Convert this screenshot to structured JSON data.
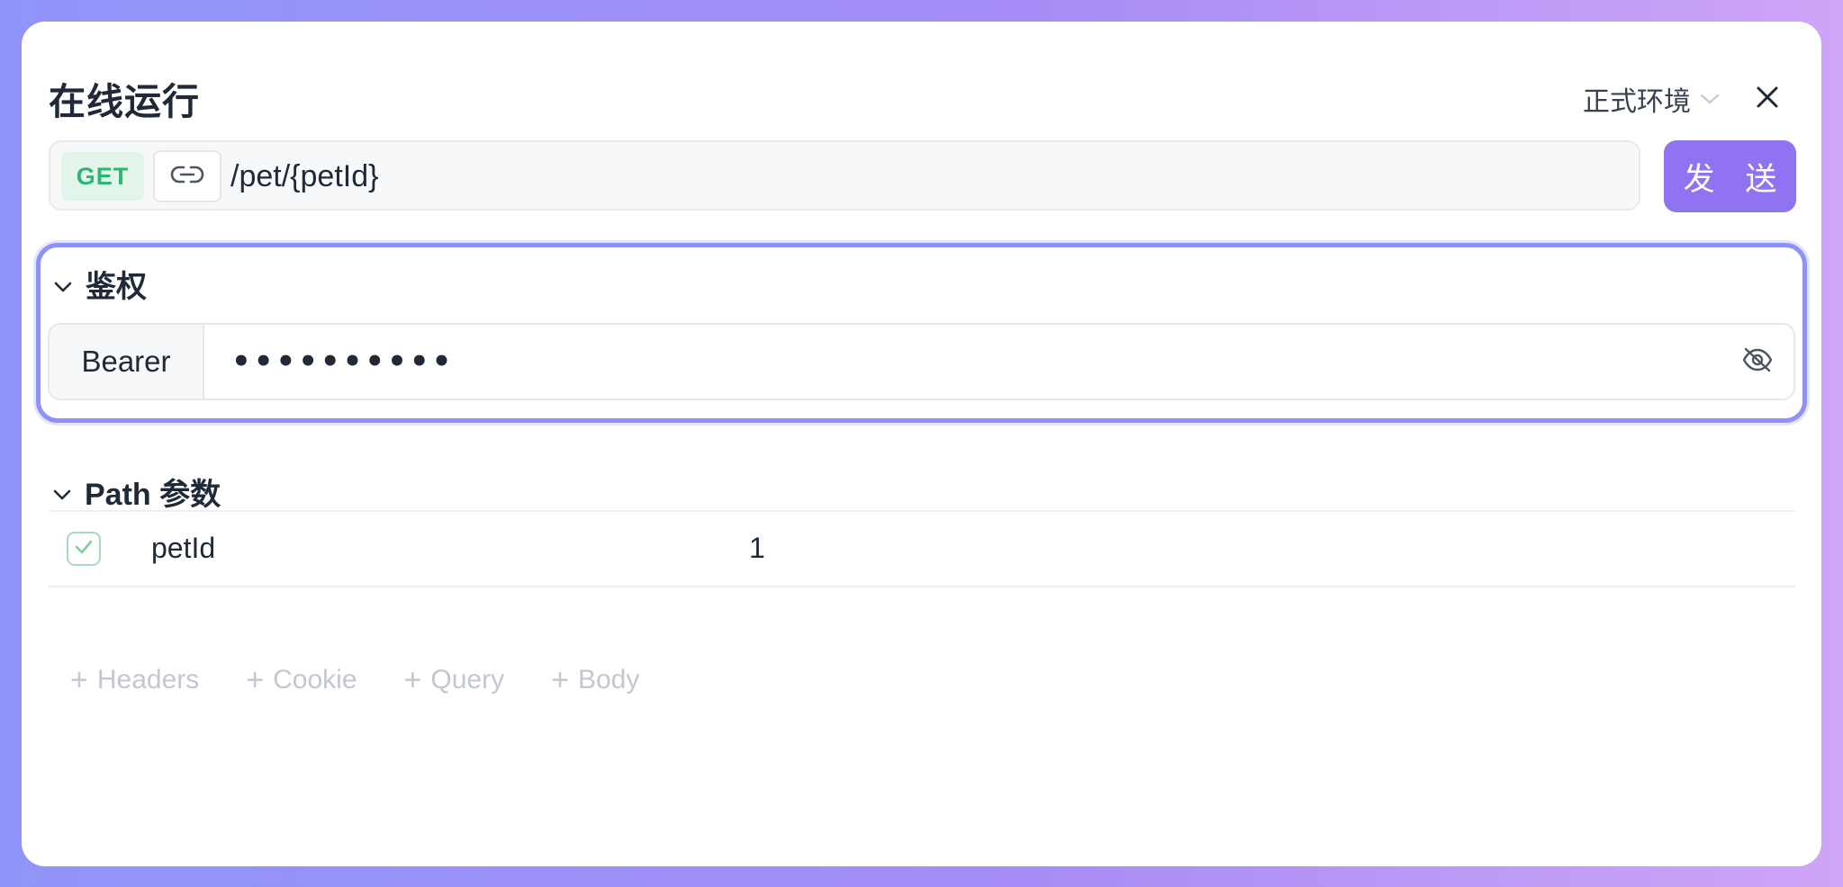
{
  "dialog": {
    "title": "在线运行",
    "environment": "正式环境",
    "close_label": "×"
  },
  "request": {
    "method": "GET",
    "path": "/pet/{petId}",
    "send_label": "发 送"
  },
  "auth": {
    "section_title": "鉴权",
    "type": "Bearer",
    "token_masked": "••••••••••"
  },
  "path_params": {
    "section_title": "Path 参数",
    "rows": [
      {
        "checked": true,
        "name": "petId",
        "value": "1"
      }
    ]
  },
  "add_actions": [
    {
      "label": "Headers"
    },
    {
      "label": "Cookie"
    },
    {
      "label": "Query"
    },
    {
      "label": "Body"
    }
  ],
  "colors": {
    "accent": "#8f73f0",
    "method_get": "#2bb673",
    "focus_border": "#8e92f5"
  }
}
